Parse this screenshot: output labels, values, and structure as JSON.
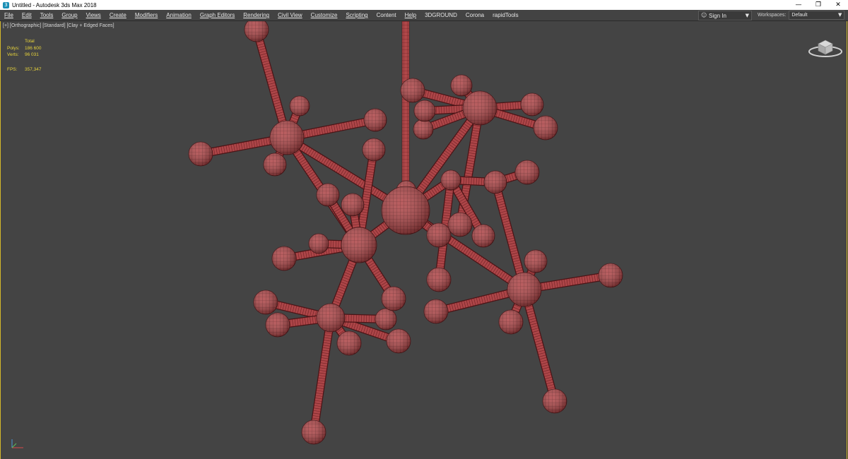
{
  "window": {
    "title": "Untitled - Autodesk 3ds Max 2018",
    "app_icon": "3ds-max-logo-icon",
    "controls": {
      "minimize": "—",
      "restore": "❐",
      "close": "✕"
    }
  },
  "menu": {
    "items": [
      {
        "label": "File"
      },
      {
        "label": "Edit"
      },
      {
        "label": "Tools"
      },
      {
        "label": "Group"
      },
      {
        "label": "Views"
      },
      {
        "label": "Create"
      },
      {
        "label": "Modifiers"
      },
      {
        "label": "Animation"
      },
      {
        "label": "Graph Editors"
      },
      {
        "label": "Rendering"
      },
      {
        "label": "Civil View"
      },
      {
        "label": "Customize"
      },
      {
        "label": "Scripting"
      },
      {
        "label": "Content"
      },
      {
        "label": "Help"
      },
      {
        "label": "3DGROUND"
      },
      {
        "label": "Corona"
      },
      {
        "label": "rapidTools"
      }
    ],
    "sign_in": "Sign In",
    "workspaces_label": "Workspaces:",
    "workspace_value": "Default"
  },
  "viewport": {
    "label": "[+] [Orthographic] [Standard] [Clay + Edged Faces]",
    "stats": {
      "header": "Total",
      "polys_label": "Polys:",
      "polys_value": "186 600",
      "verts_label": "Verts:",
      "verts_value": "96 031",
      "fps_label": "FPS:",
      "fps_value": "357,347"
    },
    "colors": {
      "background": "#444444",
      "model": "#b0484a",
      "wire": "#5a1a1c",
      "stats_text": "#e8d43a",
      "border_active": "#d4b82a"
    }
  }
}
